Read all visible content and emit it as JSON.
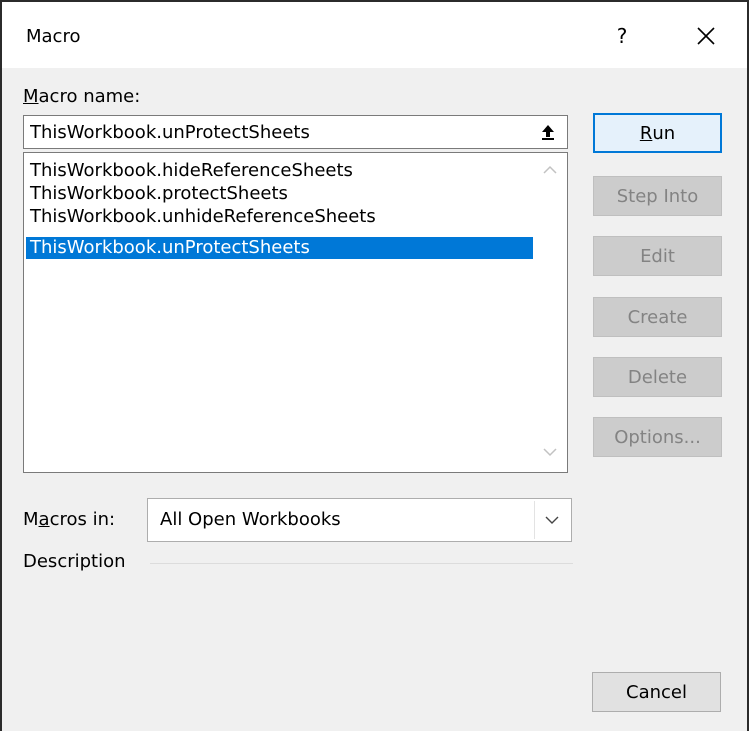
{
  "dialog": {
    "title": "Macro",
    "help_glyph": "?",
    "close_icon": "close-icon"
  },
  "macro_name": {
    "label_accel": "M",
    "label_rest": "acro name:",
    "value": "ThisWorkbook.unProtectSheets",
    "ref_icon": "upload-arrow-icon"
  },
  "macro_list": {
    "items": [
      "ThisWorkbook.hideReferenceSheets",
      "ThisWorkbook.protectSheets",
      "ThisWorkbook.unhideReferenceSheets",
      "ThisWorkbook.unProtectSheets"
    ],
    "selected_index": 3
  },
  "buttons": {
    "run_accel": "R",
    "run_rest": "un",
    "step_into": "Step Into",
    "edit": "Edit",
    "create": "Create",
    "delete": "Delete",
    "options": "Options...",
    "cancel": "Cancel"
  },
  "macros_in": {
    "label_pre": "M",
    "label_accel": "a",
    "label_rest": "cros in:",
    "value": "All Open Workbooks"
  },
  "description": {
    "label": "Description"
  },
  "colors": {
    "selection": "#0078d7",
    "default_button_border": "#0078d7"
  }
}
